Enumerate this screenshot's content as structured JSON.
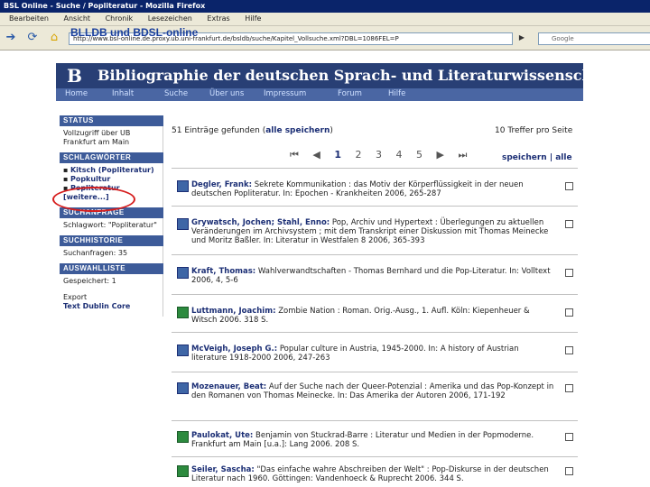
{
  "window": {
    "title": "BSL Online - Suche / Popliteratur - Mozilla Firefox"
  },
  "menu": [
    "Bearbeiten",
    "Ansicht",
    "Chronik",
    "Lesezeichen",
    "Extras",
    "Hilfe"
  ],
  "overlay_title": "BLLDB und BDSL-online",
  "url": "http://www.bsl-online.de.proxy.ub.uni-frankfurt.de/bsldb/suche/Kapitel_Vollsuche.xml?DBL=1086FEL=P",
  "search_engine_placeholder": "Google",
  "site": {
    "logo": "B",
    "title": "Bibliographie der deutschen Sprach- und Literaturwissenschaft",
    "nav": [
      "Home",
      "Inhalt",
      "Suche",
      "Über uns",
      "Impressum",
      "Forum",
      "Hilfe"
    ]
  },
  "sidebar": {
    "status": {
      "head": "STATUS",
      "line1": "Vollzugriff über UB",
      "line2": "Frankfurt am Main"
    },
    "keywords": {
      "head": "SCHLAGWÖRTER",
      "items": [
        "Kitsch (Popliteratur)",
        "Popkultur",
        "Popliteratur",
        "[weitere...]"
      ]
    },
    "query": {
      "head": "SUCHANFRAGE",
      "text": "Schlagwort: \"Popliteratur\""
    },
    "history": {
      "head": "SUCHHISTORIE",
      "text": "Suchanfragen: 35"
    },
    "selection": {
      "head": "AUSWAHLLISTE",
      "saved": "Gespeichert: 1",
      "export": "Export",
      "formats": "Text  Dublin Core"
    }
  },
  "results": {
    "count": "51 Einträge gefunden",
    "save_all_link": "alle speichern",
    "per_page": "10 Treffer pro Seite",
    "pages": [
      "1",
      "2",
      "3",
      "4",
      "5"
    ],
    "current_page": "1",
    "save_label": "speichern | alle",
    "records": [
      {
        "author": "Degler, Frank:",
        "text": "Sekrete Kommunikation : das Motiv der Körperflüssigkeit in der neuen deutschen Popliteratur. In: Epochen - Krankheiten 2006, 265-287"
      },
      {
        "author": "Grywatsch, Jochen; Stahl, Enno:",
        "text": "Pop, Archiv und Hypertext : Überlegungen zu aktuellen Veränderungen im Archivsystem ; mit dem Transkript einer Diskussion mit Thomas Meinecke und Moritz Baßler. In: Literatur in Westfalen 8 2006, 365-393"
      },
      {
        "author": "Kraft, Thomas:",
        "text": "Wahlverwandtschaften - Thomas Bernhard und die Pop-Literatur. In: Volltext 2006, 4, 5-6"
      },
      {
        "author": "Luttmann, Joachim:",
        "text": "Zombie Nation : Roman. Orig.-Ausg., 1. Aufl. Köln: Kiepenheuer & Witsch 2006. 318 S."
      },
      {
        "author": "McVeigh, Joseph G.:",
        "text": "Popular culture in Austria, 1945-2000. In: A history of Austrian literature 1918-2000 2006, 247-263"
      },
      {
        "author": "Mozenauer, Beat:",
        "text": "Auf der Suche nach der Queer-Potenzial : Amerika und das Pop-Konzept in den Romanen von Thomas Meinecke. In: Das Amerika der Autoren 2006, 171-192"
      },
      {
        "author": "Paulokat, Ute:",
        "text": "Benjamin von Stuckrad-Barre : Literatur und Medien in der Popmoderne. Frankfurt am Main [u.a.]: Lang 2006. 208 S."
      },
      {
        "author": "Seiler, Sascha:",
        "text": "\"Das einfache wahre Abschreiben der Welt\" : Pop-Diskurse in der deutschen Literatur nach 1960. Göttingen: Vandenhoeck & Ruprecht 2006. 344 S."
      }
    ]
  }
}
